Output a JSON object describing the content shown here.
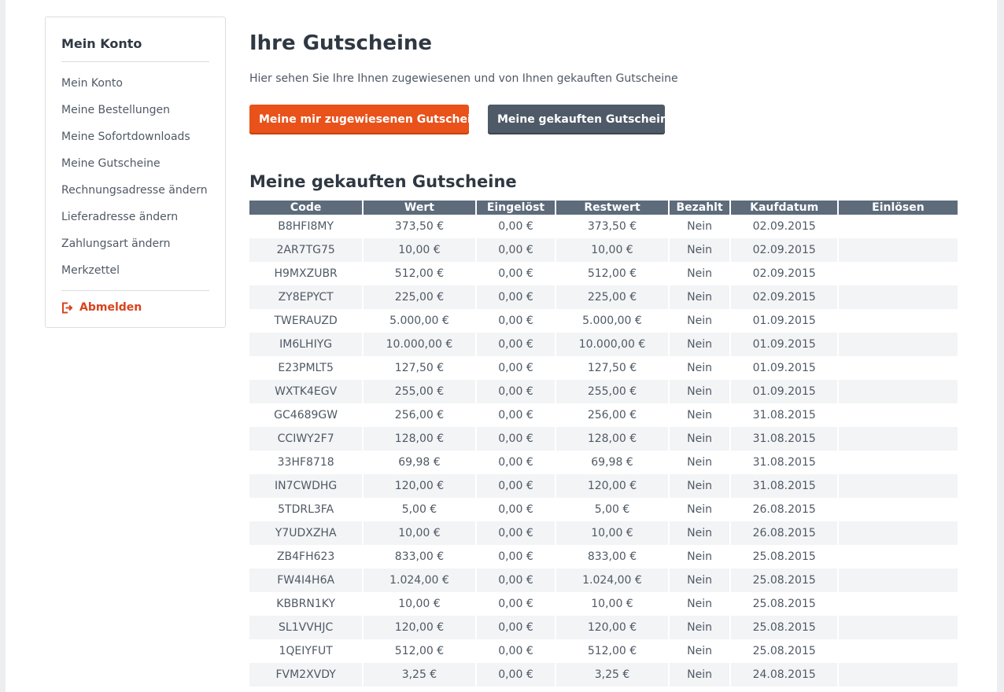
{
  "sidebar": {
    "title": "Mein Konto",
    "items": [
      {
        "label": "Mein Konto"
      },
      {
        "label": "Meine Bestellungen"
      },
      {
        "label": "Meine Sofortdownloads"
      },
      {
        "label": "Meine Gutscheine"
      },
      {
        "label": "Rechnungsadresse ändern"
      },
      {
        "label": "Lieferadresse ändern"
      },
      {
        "label": "Zahlungsart ändern"
      },
      {
        "label": "Merkzettel"
      }
    ],
    "logout_label": "Abmelden",
    "logout_icon": "logout-icon",
    "accent_color": "#d9431c"
  },
  "main": {
    "title": "Ihre Gutscheine",
    "intro": "Hier sehen Sie Ihre Ihnen zugewiesenen und von Ihnen gekauften Gutscheine",
    "btn_assigned": "Meine mir zugewiesenen Gutscheine",
    "btn_bought": "Meine gekauften Gutscheine",
    "section_title": "Meine gekauften Gutscheine",
    "colors": {
      "primary_button": "#e9521a",
      "secondary_button": "#4e5a67",
      "table_header": "#5d6b7b"
    }
  },
  "table": {
    "headers": [
      "Code",
      "Wert",
      "Eingelöst",
      "Restwert",
      "Bezahlt",
      "Kaufdatum",
      "Einlösen"
    ],
    "rows": [
      [
        "B8HFI8MY",
        "373,50 €",
        "0,00 €",
        "373,50 €",
        "Nein",
        "02.09.2015",
        ""
      ],
      [
        "2AR7TG75",
        "10,00 €",
        "0,00 €",
        "10,00 €",
        "Nein",
        "02.09.2015",
        ""
      ],
      [
        "H9MXZUBR",
        "512,00 €",
        "0,00 €",
        "512,00 €",
        "Nein",
        "02.09.2015",
        ""
      ],
      [
        "ZY8EPYCT",
        "225,00 €",
        "0,00 €",
        "225,00 €",
        "Nein",
        "02.09.2015",
        ""
      ],
      [
        "TWERAUZD",
        "5.000,00 €",
        "0,00 €",
        "5.000,00 €",
        "Nein",
        "01.09.2015",
        ""
      ],
      [
        "IM6LHIYG",
        "10.000,00 €",
        "0,00 €",
        "10.000,00 €",
        "Nein",
        "01.09.2015",
        ""
      ],
      [
        "E23PMLT5",
        "127,50 €",
        "0,00 €",
        "127,50 €",
        "Nein",
        "01.09.2015",
        ""
      ],
      [
        "WXTK4EGV",
        "255,00 €",
        "0,00 €",
        "255,00 €",
        "Nein",
        "01.09.2015",
        ""
      ],
      [
        "GC4689GW",
        "256,00 €",
        "0,00 €",
        "256,00 €",
        "Nein",
        "31.08.2015",
        ""
      ],
      [
        "CCIWY2F7",
        "128,00 €",
        "0,00 €",
        "128,00 €",
        "Nein",
        "31.08.2015",
        ""
      ],
      [
        "33HF8718",
        "69,98 €",
        "0,00 €",
        "69,98 €",
        "Nein",
        "31.08.2015",
        ""
      ],
      [
        "IN7CWDHG",
        "120,00 €",
        "0,00 €",
        "120,00 €",
        "Nein",
        "31.08.2015",
        ""
      ],
      [
        "5TDRL3FA",
        "5,00 €",
        "0,00 €",
        "5,00 €",
        "Nein",
        "26.08.2015",
        ""
      ],
      [
        "Y7UDXZHA",
        "10,00 €",
        "0,00 €",
        "10,00 €",
        "Nein",
        "26.08.2015",
        ""
      ],
      [
        "ZB4FH623",
        "833,00 €",
        "0,00 €",
        "833,00 €",
        "Nein",
        "25.08.2015",
        ""
      ],
      [
        "FW4I4H6A",
        "1.024,00 €",
        "0,00 €",
        "1.024,00 €",
        "Nein",
        "25.08.2015",
        ""
      ],
      [
        "KBBRN1KY",
        "10,00 €",
        "0,00 €",
        "10,00 €",
        "Nein",
        "25.08.2015",
        ""
      ],
      [
        "SL1VVHJC",
        "120,00 €",
        "0,00 €",
        "120,00 €",
        "Nein",
        "25.08.2015",
        ""
      ],
      [
        "1QEIYFUT",
        "512,00 €",
        "0,00 €",
        "512,00 €",
        "Nein",
        "25.08.2015",
        ""
      ],
      [
        "FVM2XVDY",
        "3,25 €",
        "0,00 €",
        "3,25 €",
        "Nein",
        "24.08.2015",
        ""
      ]
    ]
  }
}
